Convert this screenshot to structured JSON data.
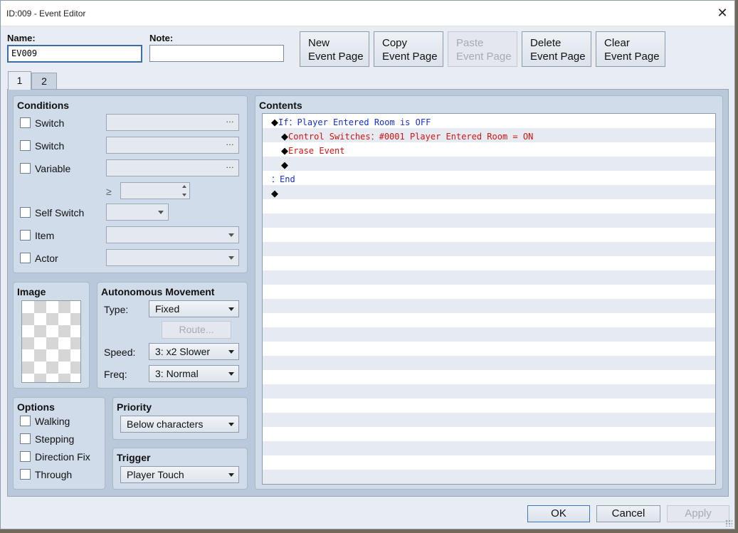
{
  "window": {
    "title": "ID:009 - Event Editor",
    "close_glyph": "✕"
  },
  "header": {
    "name_label": "Name:",
    "name_value": "EV009",
    "note_label": "Note:",
    "note_value": "",
    "buttons": {
      "new_page": [
        "New",
        "Event Page"
      ],
      "copy_page": [
        "Copy",
        "Event Page"
      ],
      "paste_page": [
        "Paste",
        "Event Page"
      ],
      "delete_page": [
        "Delete",
        "Event Page"
      ],
      "clear_page": [
        "Clear",
        "Event Page"
      ]
    }
  },
  "tabs": [
    {
      "label": "1",
      "selected": true
    },
    {
      "label": "2",
      "selected": false
    }
  ],
  "conditions": {
    "title": "Conditions",
    "switch1_label": "Switch",
    "switch2_label": "Switch",
    "variable_label": "Variable",
    "gte_symbol": "≥",
    "self_switch_label": "Self Switch",
    "item_label": "Item",
    "actor_label": "Actor",
    "ellipsis": "…"
  },
  "image": {
    "title": "Image"
  },
  "movement": {
    "title": "Autonomous Movement",
    "type_label": "Type:",
    "type_value": "Fixed",
    "route_label": "Route...",
    "speed_label": "Speed:",
    "speed_value": "3: x2 Slower",
    "freq_label": "Freq:",
    "freq_value": "3: Normal"
  },
  "options": {
    "title": "Options",
    "walking_label": "Walking",
    "stepping_label": "Stepping",
    "direction_fix_label": "Direction Fix",
    "through_label": "Through"
  },
  "priority": {
    "title": "Priority",
    "value": "Below characters"
  },
  "trigger": {
    "title": "Trigger",
    "value": "Player Touch"
  },
  "contents": {
    "title": "Contents",
    "lines": [
      {
        "marker": "◆",
        "text": "If：Player Entered Room is OFF",
        "color": "#1730c8"
      },
      {
        "marker": "◆",
        "text": "Control Switches：#0001 Player Entered Room = ON",
        "color": "#d41313"
      },
      {
        "marker": "◆",
        "text": "Erase Event",
        "color": "#d41313"
      },
      {
        "marker": "◆",
        "text": "",
        "color": "#000000"
      },
      {
        "marker": "：",
        "text": "End",
        "color": "#1730c8"
      },
      {
        "marker": "◆",
        "text": "",
        "color": "#000000"
      }
    ]
  },
  "footer": {
    "ok": "OK",
    "cancel": "Cancel",
    "apply": "Apply"
  }
}
